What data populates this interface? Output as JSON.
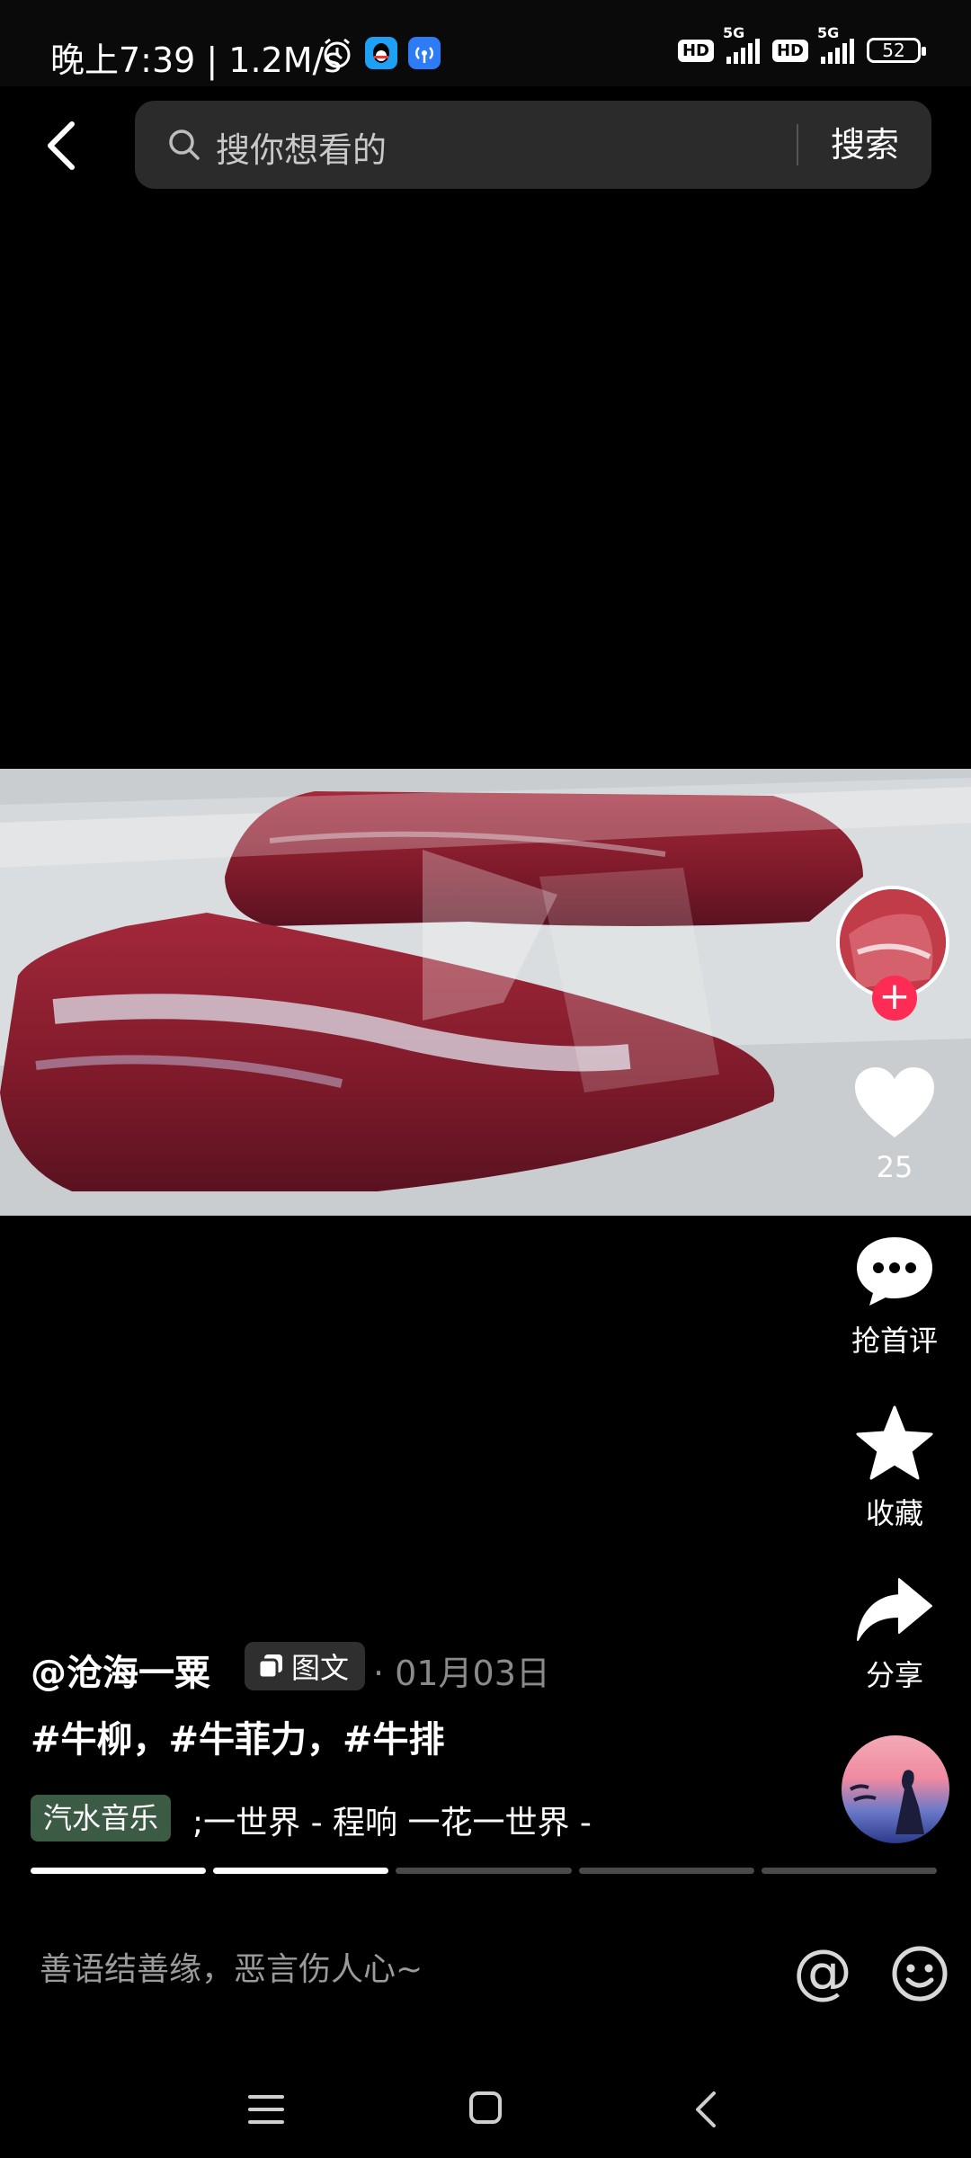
{
  "status_bar": {
    "time": "晚上7:39 | 1.2M/s",
    "network_1": "5G",
    "network_2": "5G",
    "hd_1": "HD",
    "hd_2": "HD",
    "battery": "52"
  },
  "header": {
    "search_placeholder": "搜你想看的",
    "search_button": "搜索"
  },
  "rail": {
    "like_count": "25",
    "comment_label": "抢首评",
    "favorite_label": "收藏",
    "share_label": "分享"
  },
  "post": {
    "author": "@沧海一粟",
    "type_badge": "图文",
    "date": "· 01月03日",
    "hashtags": "#牛柳，#牛菲力，#牛排",
    "music_tag": "汽水音乐",
    "music_title": ";一世界 - 程响    一花一世界 -",
    "progress": {
      "total_segments": 5,
      "active_segments": 2
    }
  },
  "comment_bar": {
    "placeholder": "善语结善缘，恶言伤人心~",
    "mention": "@"
  },
  "colors": {
    "accent": "#fe2c55",
    "music_tag_bg": "#3b5b45",
    "search_bg": "#2b2b2b"
  },
  "icons": [
    "back-icon",
    "search-icon",
    "alarm-icon",
    "qq-icon",
    "hotspot-icon",
    "heart-icon",
    "comment-icon",
    "star-icon",
    "share-icon",
    "image-text-icon",
    "emoji-icon",
    "nav-menu-icon",
    "nav-home-icon",
    "nav-back-icon"
  ]
}
